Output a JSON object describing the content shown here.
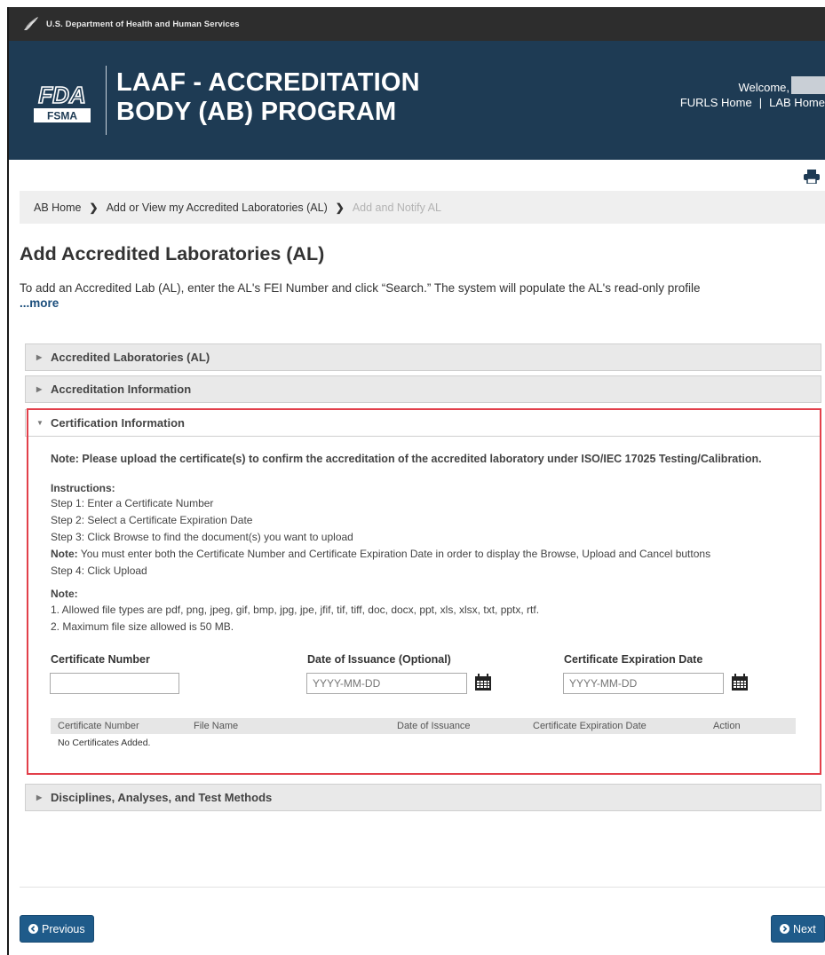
{
  "hhs_bar": {
    "text": "U.S. Department of Health and Human Services",
    "icon": "hhs-eagle-icon"
  },
  "banner": {
    "logo_top": "FDA",
    "logo_bottom": "FSMA",
    "title_line1": "LAAF - ACCREDITATION",
    "title_line2": "BODY (AB) PROGRAM",
    "welcome": "Welcome,",
    "links": [
      "FURLS Home",
      "|",
      "LAB Home"
    ]
  },
  "breadcrumb": {
    "items": [
      "AB Home",
      "Add or View my Accredited Laboratories (AL)"
    ],
    "current": "Add and Notify AL"
  },
  "page": {
    "title": "Add Accredited Laboratories (AL)",
    "intro": "To add an Accredited Lab (AL), enter the AL's FEI Number and click “Search.” The system will populate the AL's read-only profile",
    "more": "...more"
  },
  "accordion": {
    "sections": [
      "Accredited Laboratories (AL)",
      "Accreditation Information",
      "Certification Information",
      "Disciplines, Analyses, and Test Methods"
    ]
  },
  "certification": {
    "note": "Note: Please upload the certificate(s) to confirm the accreditation of the accredited laboratory under ISO/IEC 17025 Testing/Calibration.",
    "instructions_title": "Instructions:",
    "steps": [
      "Step 1: Enter a Certificate Number",
      "Step 2: Select a Certificate Expiration Date",
      "Step 3: Click Browse to find the document(s) you want to upload"
    ],
    "step_note_label": "Note:",
    "step_note_text": " You must enter both the Certificate Number and Certificate Expiration Date in order to display the Browse, Upload and Cancel buttons",
    "step4": "Step 4: Click Upload",
    "note2_title": "Note:",
    "note2_items": [
      "1. Allowed file types are pdf, png, jpeg, gif, bmp, jpg, jpe, jfif, tif, tiff, doc, docx, ppt, xls, xlsx, txt, pptx, rtf.",
      "2. Maximum file size allowed is 50 MB."
    ],
    "fields": {
      "cert_number_label": "Certificate Number",
      "cert_number_value": "",
      "issuance_label": "Date of Issuance (Optional)",
      "issuance_placeholder": "YYYY-MM-DD",
      "expiration_label": "Certificate Expiration Date",
      "expiration_placeholder": "YYYY-MM-DD"
    },
    "table": {
      "columns": [
        "Certificate Number",
        "File Name",
        "Date of Issuance",
        "Certificate Expiration Date",
        "Action"
      ],
      "empty": "No Certificates Added."
    }
  },
  "nav": {
    "previous": "Previous",
    "next": "Next"
  },
  "colors": {
    "banner": "#1e3b54",
    "button": "#1f5b8a",
    "highlight": "#e23f4a"
  }
}
